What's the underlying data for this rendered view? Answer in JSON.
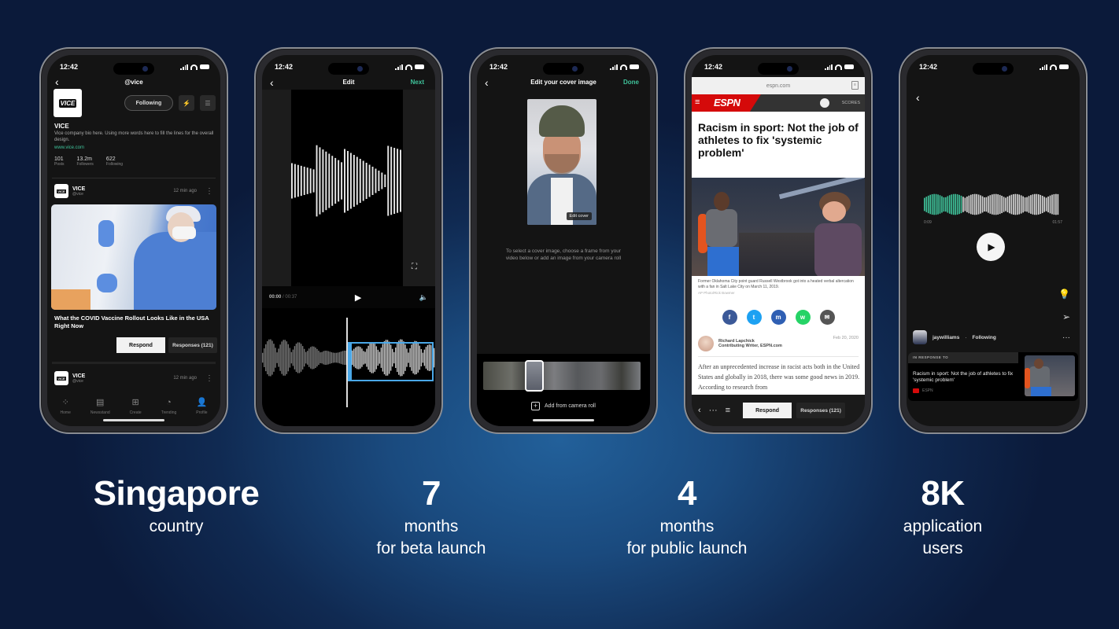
{
  "status_time": "12:42",
  "phones": {
    "profile": {
      "handle": "@vice",
      "logo_text": "VICE",
      "following_label": "Following",
      "bolt_icon": "⚡",
      "menu_icon": "☰",
      "name": "VICE",
      "bio": "Vice company bio here. Using more words here to fill the lines for the overall design.",
      "link": "www.vice.com",
      "stats": [
        {
          "value": "101",
          "label": "Posts"
        },
        {
          "value": "13.2m",
          "label": "Followers"
        },
        {
          "value": "622",
          "label": "Following"
        }
      ],
      "posts": [
        {
          "author": "VICE",
          "handle": "@vice",
          "time": "12 min ago"
        },
        {
          "author": "VICE",
          "handle": "@vice",
          "time": "12 min ago"
        }
      ],
      "headline": "What the COVID Vaccine Rollout Looks Like in the USA Right Now",
      "respond_label": "Respond",
      "responses_label": "Responses (121)",
      "tabs": [
        {
          "icon": "⁘",
          "label": "Home"
        },
        {
          "icon": "▤",
          "label": "Newsstand"
        },
        {
          "icon": "⊞",
          "label": "Create"
        },
        {
          "icon": "◔",
          "label": "Trending"
        },
        {
          "icon": "👤",
          "label": "Profile"
        }
      ]
    },
    "edit": {
      "title": "Edit",
      "next_label": "Next",
      "current_time": "00:00",
      "total_time": "/ 00:37",
      "play_icon": "▶",
      "volume_icon": "🔈",
      "expand_icon": "⛶"
    },
    "cover": {
      "title": "Edit your cover image",
      "done_label": "Done",
      "edit_cover_label": "Edit cover",
      "hint": "To select a cover image, choose a frame from your video below or add an image from your camera roll",
      "add_label": "Add from camera roll"
    },
    "article": {
      "url": "espn.com",
      "brand": "ESPN",
      "scores_label": "SCORES",
      "headline": "Racism in sport: Not the job of athletes to fix 'systemic problem'",
      "caption": "Former Oklahoma City point guard Russell Westbrook got into a heated verbal altercation with a fan in Salt Lake City on March 11, 2019.",
      "credit": "AP Photo/Rick Bowmer",
      "share": [
        {
          "name": "facebook",
          "glyph": "f",
          "color": "#3b5998"
        },
        {
          "name": "twitter",
          "glyph": "t",
          "color": "#1da1f2"
        },
        {
          "name": "messenger",
          "glyph": "m",
          "color": "#2f5fb3"
        },
        {
          "name": "whatsapp",
          "glyph": "w",
          "color": "#25d366"
        },
        {
          "name": "email",
          "glyph": "✉",
          "color": "#555"
        }
      ],
      "author_name": "Richard Lapchick",
      "author_title": "Contributing Writer, ESPN.com",
      "date": "Feb 20, 2020",
      "body": "After an unprecedented increase in racist acts both in the United States and globally in 2018, there was some good news in 2019. According to research from",
      "respond_label": "Respond",
      "responses_label": "Responses (121)"
    },
    "player": {
      "start_time": "0:09",
      "end_time": "01:57",
      "progress_pct": 28,
      "username": "jaywilliams",
      "follow_status": "Following",
      "in_response_label": "IN RESPONSE TO",
      "response_title": "Racism in sport: Not the job of athletes to fix 'systemic problem'",
      "response_source": "ESPN"
    }
  },
  "stats": [
    {
      "value": "Singapore",
      "label_lines": [
        "country"
      ]
    },
    {
      "value": "7",
      "label_lines": [
        "months",
        "for beta launch"
      ]
    },
    {
      "value": "4",
      "label_lines": [
        "months",
        "for public launch"
      ]
    },
    {
      "value": "8K",
      "label_lines": [
        "application",
        "users"
      ]
    }
  ],
  "colors": {
    "accent_green": "#3fc29a",
    "espn_red": "#d50a0a",
    "selection_blue": "#4aa8e8"
  }
}
